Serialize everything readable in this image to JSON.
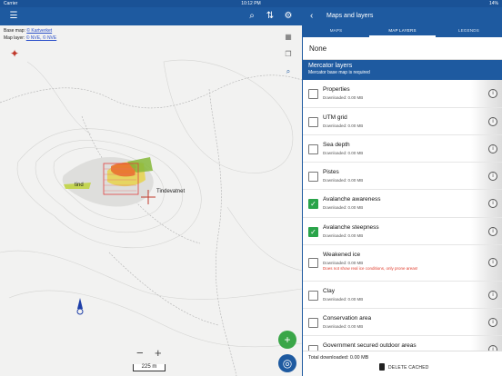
{
  "status_bar": {
    "carrier": "Carrier",
    "time": "10:12 PM",
    "battery": "14%"
  },
  "map": {
    "base_map_label": "Base map:",
    "base_map_value": "© Kartverket",
    "map_layer_label": "Map layer:",
    "map_layer_value": "© NVE, © NVE",
    "place_labels": [
      "tind",
      "Tindevatnet"
    ],
    "scale_text": "225 m",
    "zoom_out": "−",
    "zoom_in": "+",
    "icons": [
      "menu-icon",
      "search-icon",
      "sort-icon",
      "gear-icon",
      "map-icon",
      "layers-icon",
      "zoom-icon",
      "compass-icon",
      "add-icon",
      "locate-icon"
    ]
  },
  "panel": {
    "title": "Maps and layers",
    "tabs": [
      "MAPS",
      "MAP LAYERS",
      "LEGENDS"
    ],
    "active_tab": "MAP LAYERS",
    "none_option": "None",
    "section_title": "Mercator layers",
    "section_subtitle": "Mercator base map is required",
    "layers": [
      {
        "name": "Properties",
        "sub": "Downloaded: 0.00 MB",
        "checked": false
      },
      {
        "name": "UTM grid",
        "sub": "Downloaded: 0.00 MB",
        "checked": false
      },
      {
        "name": "Sea depth",
        "sub": "Downloaded: 0.00 MB",
        "checked": false
      },
      {
        "name": "Pistes",
        "sub": "Downloaded: 0.00 MB",
        "checked": false
      },
      {
        "name": "Avalanche awareness",
        "sub": "Downloaded: 0.00 MB",
        "checked": true
      },
      {
        "name": "Avalanche steepness",
        "sub": "Downloaded: 0.00 MB",
        "checked": true
      },
      {
        "name": "Weakened ice",
        "sub": "Downloaded: 0.00 MB",
        "warning": "Does not show real ice conditions, only prone areas!",
        "checked": false
      },
      {
        "name": "Clay",
        "sub": "Downloaded: 0.00 MB",
        "checked": false
      },
      {
        "name": "Conservation area",
        "sub": "Downloaded: 0.00 MB",
        "checked": false
      },
      {
        "name": "Government secured outdoor areas",
        "sub": "",
        "checked": false
      }
    ],
    "total_downloaded": "Total downloaded: 0.00 MB",
    "delete_cached": "DELETE CACHED"
  },
  "colors": {
    "primary": "#1e5aa0",
    "check_green": "#2aa44a",
    "warning_red": "#e03a2a",
    "fab_green": "#3aa648"
  }
}
